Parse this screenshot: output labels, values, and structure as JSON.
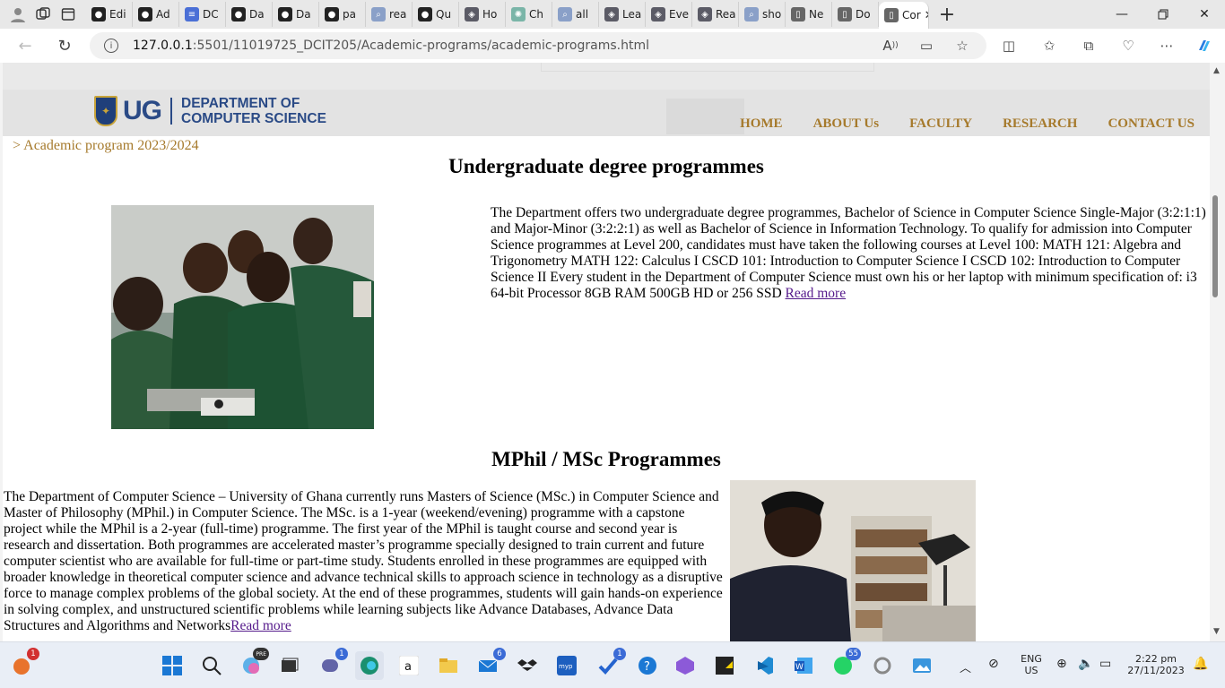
{
  "browser": {
    "tabs": [
      {
        "label": "Edi",
        "icon": "github-icon"
      },
      {
        "label": "Ad",
        "icon": "github-icon"
      },
      {
        "label": "DC",
        "icon": "doc-icon"
      },
      {
        "label": "Da",
        "icon": "github-icon"
      },
      {
        "label": "Da",
        "icon": "github-icon"
      },
      {
        "label": "pa",
        "icon": "github-icon"
      },
      {
        "label": "rea",
        "icon": "search-icon"
      },
      {
        "label": "Qu",
        "icon": "github-icon"
      },
      {
        "label": "Ho",
        "icon": "app-icon"
      },
      {
        "label": "Ch",
        "icon": "chatgpt-icon"
      },
      {
        "label": "all",
        "icon": "search-icon"
      },
      {
        "label": "Lea",
        "icon": "app-icon"
      },
      {
        "label": "Eve",
        "icon": "app-icon"
      },
      {
        "label": "Rea",
        "icon": "app-icon"
      },
      {
        "label": "sho",
        "icon": "search-icon"
      },
      {
        "label": "Ne",
        "icon": "page-icon"
      },
      {
        "label": "Do",
        "icon": "page-icon"
      },
      {
        "label": "Cor",
        "icon": "page-icon",
        "active": true
      }
    ],
    "url_host": "127.0.0.1",
    "url_path": ":5501/11019725_DCIT205/Academic-programs/academic-programs.html"
  },
  "site": {
    "logo_ug": "UG",
    "logo_dept_line1": "DEPARTMENT OF",
    "logo_dept_line2": "COMPUTER SCIENCE",
    "nav": [
      "HOME",
      "ABOUT Us",
      "FACULTY",
      "RESEARCH",
      "CONTACT US"
    ]
  },
  "content": {
    "breadcrumb": "> Academic program 2023/2024",
    "undergrad": {
      "heading": "Undergraduate degree programmes",
      "text": "The Department offers two undergraduate degree programmes, Bachelor of Science in Computer Science Single-Major (3:2:1:1) and Major-Minor (3:2:2:1) as well as Bachelor of Science in Information Technology. To qualify for admission into Computer Science programmes at Level 200, candidates must have taken the following courses at Level 100: MATH 121: Algebra and Trigonometry MATH 122: Calculus I CSCD 101: Introduction to Computer Science I CSCD 102: Introduction to Computer Science II Every student in the Department of Computer Science must own his or her laptop with minimum specification of: i3 64-bit Processor 8GB RAM 500GB HD or 256 SSD ",
      "read_more": "Read more"
    },
    "postgrad": {
      "heading": "MPhil / MSc Programmes",
      "text": "The Department of Computer Science – University of Ghana currently runs Masters of Science (MSc.) in Computer Science and Master of Philosophy (MPhil.) in Computer Science. The MSc. is a 1-year (weekend/evening) programme with a capstone project while the MPhil is a 2-year (full-time) programme. The first year of the MPhil is taught course and second year is research and dissertation. Both programmes are accelerated master’s programme specially designed to train current and future computer scientist who are available for full-time or part-time study. Students enrolled in these programmes are equipped with broader knowledge in theoretical computer science and advance technical skills to approach science in technology as a disruptive force to manage complex problems of the global society. At the end of these programmes, students will gain hands-on experience in solving complex, and unstructured scientific problems while learning subjects like Advance Databases, Advance Data Structures and Algorithms and Networks",
      "read_more": "Read more"
    }
  },
  "taskbar": {
    "badges": {
      "copilot": "1",
      "teams": "1",
      "mail": "6",
      "todo": "1",
      "whatsapp": "55"
    },
    "lang": "ENG",
    "region": "US",
    "time": "2:22 pm",
    "date": "27/11/2023"
  }
}
